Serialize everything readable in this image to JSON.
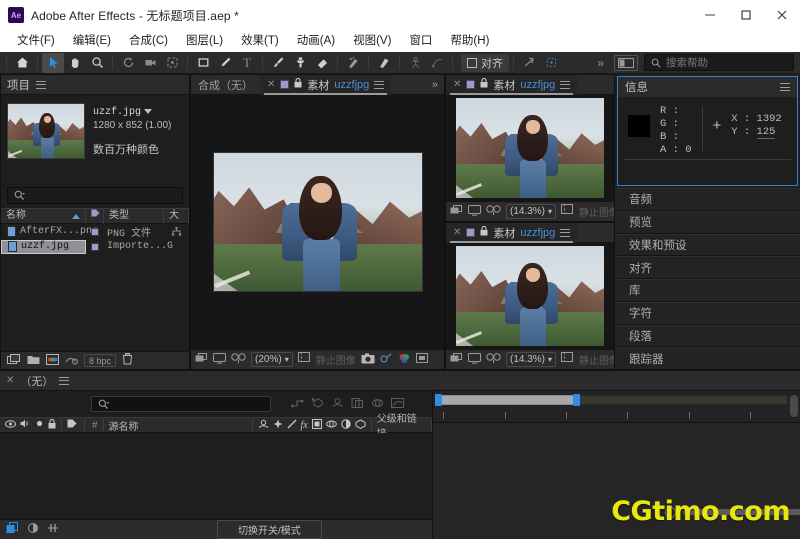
{
  "window": {
    "app_badge": "Ae",
    "title": "Adobe After Effects - 无标题项目.aep *",
    "minimize": "—",
    "maximize": "□",
    "close": "✕"
  },
  "menu": {
    "items": [
      "文件(F)",
      "编辑(E)",
      "合成(C)",
      "图层(L)",
      "效果(T)",
      "动画(A)",
      "视图(V)",
      "窗口",
      "帮助(H)"
    ]
  },
  "toolbar": {
    "tools": [
      {
        "name": "home-icon",
        "label": "主页"
      },
      {
        "name": "selection-tool-icon",
        "label": "选取工具"
      },
      {
        "name": "hand-tool-icon",
        "label": "手形工具"
      },
      {
        "name": "zoom-tool-icon",
        "label": "缩放工具"
      },
      {
        "name": "rotation-tool-icon",
        "label": "旋转工具"
      },
      {
        "name": "camera-tool-icon",
        "label": "摄像机工具"
      },
      {
        "name": "pan-behind-tool-icon",
        "label": "向后平移工具"
      },
      {
        "name": "shape-tool-icon",
        "label": "形状工具"
      },
      {
        "name": "pen-tool-icon",
        "label": "钢笔工具"
      },
      {
        "name": "type-tool-icon",
        "label": "文字工具"
      },
      {
        "name": "brush-tool-icon",
        "label": "画笔工具"
      },
      {
        "name": "clone-stamp-tool-icon",
        "label": "仿制图章工具"
      },
      {
        "name": "eraser-tool-icon",
        "label": "橡皮擦工具"
      },
      {
        "name": "roto-brush-tool-icon",
        "label": "Roto 笔刷工具"
      },
      {
        "name": "puppet-pin-tool-icon",
        "label": "人偶工具"
      },
      {
        "name": "puppet-advanced-icon",
        "label": "人偶高级"
      },
      {
        "name": "puppet-bend-icon",
        "label": "人偶扭曲"
      }
    ],
    "align_label": "对齐",
    "overflow": "»",
    "search_placeholder": "搜索帮助"
  },
  "project": {
    "title": "项目",
    "selected_asset": {
      "filename": "uzzf.jpg",
      "dimensions": "1280 x 852 (1.00)",
      "colors": "数百万种颜色"
    },
    "search_placeholder": "",
    "columns": [
      "名称",
      "类型",
      "大"
    ],
    "rows": [
      {
        "name": "AfterFX...png",
        "type": "PNG 文件",
        "selected": false
      },
      {
        "name": "uzzf.jpg",
        "type": "Importe...G",
        "selected": true
      }
    ],
    "footer": {
      "new_comp": "新建合成",
      "new_folder": "新建文件夹",
      "project_settings": "项目设置",
      "bit_depth": "8 bpc",
      "delete": "删除"
    }
  },
  "composition": {
    "tabs": [
      {
        "label": "合成（无）",
        "active": false,
        "closable": false
      },
      {
        "label": "素材",
        "file": "uzzfjpg",
        "active": true,
        "closable": true
      }
    ],
    "viewbar": {
      "zoom": "(20%)",
      "resolution": "静止图像"
    }
  },
  "right_viewers": [
    {
      "tab_label": "素材",
      "file": "uzzfjpg",
      "zoom": "(14.3%)",
      "resolution": "静止图像"
    },
    {
      "tab_label": "素材",
      "file": "uzzfjpg",
      "zoom": "(14.3%)",
      "resolution": "静止图像"
    }
  ],
  "info_panel": {
    "title": "信息",
    "r_label": "R :",
    "r_value": "",
    "g_label": "G :",
    "g_value": "",
    "b_label": "B :",
    "b_value": "",
    "a_label": "A :",
    "a_value": "0",
    "x_label": "X :",
    "x_value": "1392",
    "y_label": "Y :",
    "y_value": "125",
    "swatch_color": "#000000",
    "border_color": "#2e85d8"
  },
  "sidebar_panels": [
    "音频",
    "预览",
    "效果和预设",
    "对齐",
    "库",
    "字符",
    "段落",
    "跟踪器"
  ],
  "timeline": {
    "tab_label": "（无）",
    "search_placeholder": "",
    "columns": {
      "source_name": "源名称",
      "index": "#",
      "parent_link": "父级和链接"
    },
    "switch_modes": "切换开关/模式"
  },
  "watermark": "CGtimo.com",
  "colors": {
    "accent": "#2e85d8",
    "link": "#4a90d9",
    "panel_bg": "#1e1e1e",
    "header_bg": "#2b2b2b",
    "watermark": "#e8e80f"
  }
}
